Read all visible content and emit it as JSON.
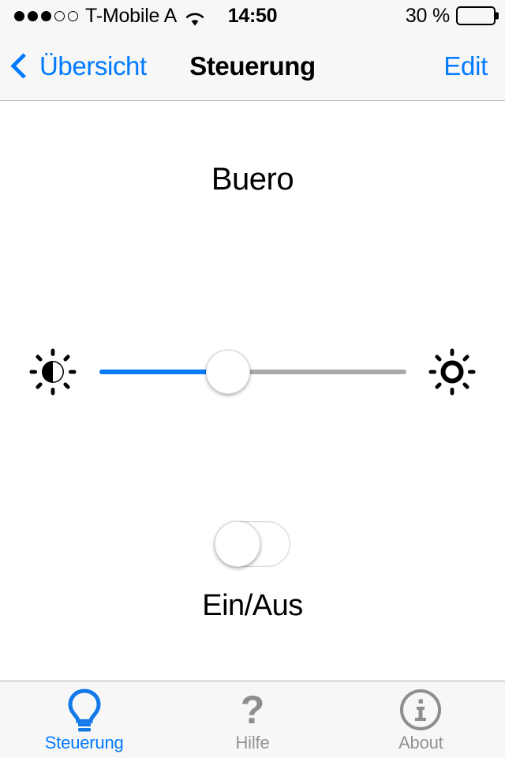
{
  "status_bar": {
    "signal_dots_total": 5,
    "signal_dots_filled": 3,
    "carrier": "T-Mobile A",
    "wifi_icon": "wifi-icon",
    "time": "14:50",
    "battery_percent_label": "30 %",
    "battery_level": 33
  },
  "nav_bar": {
    "back_icon": "chevron-left-icon",
    "back_label": "Übersicht",
    "title": "Steuerung",
    "edit_label": "Edit"
  },
  "main": {
    "room_title": "Buero",
    "slider": {
      "min_icon": "brightness-low-icon",
      "max_icon": "brightness-high-icon",
      "value_percent": 42,
      "fill_color": "#047aff",
      "track_color": "#aaaaaa"
    },
    "toggle": {
      "state": "off",
      "label": "Ein/Aus"
    }
  },
  "tab_bar": {
    "items": [
      {
        "label": "Steuerung",
        "icon": "lightbulb-icon",
        "active": true
      },
      {
        "label": "Hilfe",
        "icon": "question-mark-icon",
        "active": false
      },
      {
        "label": "About",
        "icon": "info-circle-icon",
        "active": false
      }
    ]
  },
  "colors": {
    "accent_blue": "#007aff",
    "bar_background": "#f7f7f7",
    "inactive_gray": "#929292"
  }
}
